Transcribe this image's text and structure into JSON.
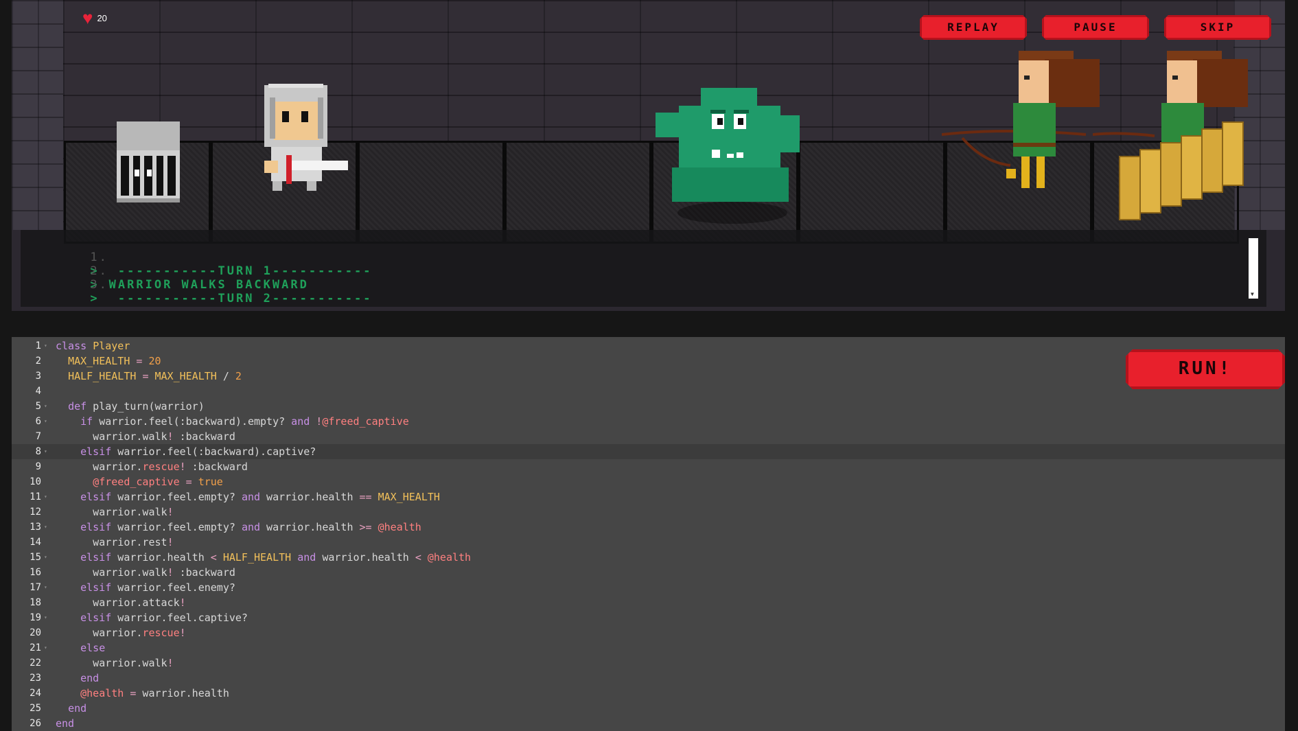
{
  "hud": {
    "health": "20",
    "heart_icon": "heart-icon"
  },
  "controls": {
    "replay": "REPLAY",
    "pause": "PAUSE",
    "skip": "SKIP"
  },
  "log": [
    {
      "num": "1.",
      "caret": ">",
      "text": " -----------TURN 1-----------"
    },
    {
      "num": "2.",
      "caret": ">",
      "text": "WARRIOR WALKS BACKWARD"
    },
    {
      "num": "3.",
      "caret": ">",
      "text": " -----------TURN 2-----------"
    }
  ],
  "editor": {
    "run_label": "RUN!",
    "lines": [
      {
        "n": "1",
        "fold": true,
        "html": "<span class=\"kw\">class</span> <span class=\"cls\">Player</span>"
      },
      {
        "n": "2",
        "fold": false,
        "html": "  <span class=\"const\">MAX_HEALTH</span> <span class=\"op\">=</span> <span class=\"num\">20</span>"
      },
      {
        "n": "3",
        "fold": false,
        "html": "  <span class=\"const\">HALF_HEALTH</span> <span class=\"op\">=</span> <span class=\"const\">MAX_HEALTH</span> / <span class=\"num\">2</span>"
      },
      {
        "n": "4",
        "fold": false,
        "html": ""
      },
      {
        "n": "5",
        "fold": true,
        "html": "  <span class=\"kw\">def</span> play_turn(warrior)"
      },
      {
        "n": "6",
        "fold": true,
        "html": "    <span class=\"kw\">if</span> warrior.feel(:backward).empty? <span class=\"kw\">and</span> <span class=\"op\">!</span><span class=\"ivar\">@freed_captive</span>"
      },
      {
        "n": "7",
        "fold": false,
        "html": "      warrior.walk<span class=\"op\">!</span> :backward"
      },
      {
        "n": "8",
        "fold": true,
        "active": true,
        "html": "    <span class=\"kw\">elsif</span> warrior.feel(:backward).captive?"
      },
      {
        "n": "9",
        "fold": false,
        "html": "      warrior.<span class=\"method-bang\">rescue</span><span class=\"op\">!</span> :backward"
      },
      {
        "n": "10",
        "fold": false,
        "html": "      <span class=\"ivar\">@freed_captive</span> <span class=\"op\">=</span> <span class=\"bool\">true</span>"
      },
      {
        "n": "11",
        "fold": true,
        "html": "    <span class=\"kw\">elsif</span> warrior.feel.empty? <span class=\"kw\">and</span> warrior.health <span class=\"op\">==</span> <span class=\"const\">MAX_HEALTH</span>"
      },
      {
        "n": "12",
        "fold": false,
        "html": "      warrior.walk<span class=\"op\">!</span>"
      },
      {
        "n": "13",
        "fold": true,
        "html": "    <span class=\"kw\">elsif</span> warrior.feel.empty? <span class=\"kw\">and</span> warrior.health <span class=\"op\">&gt;=</span> <span class=\"ivar\">@health</span>"
      },
      {
        "n": "14",
        "fold": false,
        "html": "      warrior.rest<span class=\"op\">!</span>"
      },
      {
        "n": "15",
        "fold": true,
        "html": "    <span class=\"kw\">elsif</span> warrior.health <span class=\"op\">&lt;</span> <span class=\"const\">HALF_HEALTH</span> <span class=\"kw\">and</span> warrior.health <span class=\"op\">&lt;</span> <span class=\"ivar\">@health</span>"
      },
      {
        "n": "16",
        "fold": false,
        "html": "      warrior.walk<span class=\"op\">!</span> :backward"
      },
      {
        "n": "17",
        "fold": true,
        "html": "    <span class=\"kw\">elsif</span> warrior.feel.enemy?"
      },
      {
        "n": "18",
        "fold": false,
        "html": "      warrior.attack<span class=\"op\">!</span>"
      },
      {
        "n": "19",
        "fold": true,
        "html": "    <span class=\"kw\">elsif</span> warrior.feel.captive?"
      },
      {
        "n": "20",
        "fold": false,
        "html": "      warrior.<span class=\"method-bang\">rescue</span><span class=\"op\">!</span>"
      },
      {
        "n": "21",
        "fold": true,
        "html": "    <span class=\"kw\">else</span>"
      },
      {
        "n": "22",
        "fold": false,
        "html": "      warrior.walk<span class=\"op\">!</span>"
      },
      {
        "n": "23",
        "fold": false,
        "html": "    <span class=\"kw\">end</span>"
      },
      {
        "n": "24",
        "fold": false,
        "html": "    <span class=\"ivar\">@health</span> <span class=\"op\">=</span> warrior.health"
      },
      {
        "n": "25",
        "fold": false,
        "html": "  <span class=\"kw\">end</span>"
      },
      {
        "n": "26",
        "fold": false,
        "html": "<span class=\"kw\">end</span>"
      }
    ]
  },
  "colors": {
    "accent_red": "#e8202c",
    "log_green": "#1fa05a",
    "slime_green": "#1f9b6a"
  }
}
